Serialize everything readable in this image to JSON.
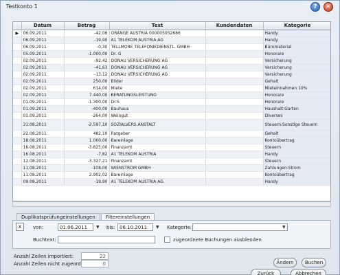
{
  "window": {
    "title": "Testkonto 1"
  },
  "table": {
    "headers": [
      "Datum",
      "Betrag",
      "Text",
      "Kundendaten",
      "Kategorie"
    ],
    "rows": [
      [
        "06.09.2011",
        "-42,06",
        "ORANGE AUSTRIA 000005052686",
        "",
        "Handy"
      ],
      [
        "06.09.2011",
        "-19,90",
        "A1 TELEKOM AUSTRIA AG",
        "",
        "Handy"
      ],
      [
        "06.09.2011",
        "-0,30",
        "TELLMORE TELEFONIEDIENSTL. GMBH",
        "",
        "Büromaterial"
      ],
      [
        "05.09.2011",
        "-1.000,00",
        "Dr. G",
        "",
        "Honorare"
      ],
      [
        "02.09.2011",
        "-92,42",
        "DONAU VERSICHERUNG AG",
        "",
        "Versicherung"
      ],
      [
        "02.09.2011",
        "-41,63",
        "DONAU VERSICHERUNG AG",
        "",
        "Versicherung"
      ],
      [
        "02.09.2011",
        "-13,12",
        "DONAU VERSICHERUNG AG",
        "",
        "Versicherung"
      ],
      [
        "02.09.2011",
        "250,00",
        "Bilder",
        "",
        "Gehalt"
      ],
      [
        "02.09.2011",
        "614,00",
        "Miete",
        "",
        "Mieteinnahmen 10%"
      ],
      [
        "02.09.2011",
        "7.440,00",
        "BERATUNGSLEISTUNG",
        "",
        "Honorare"
      ],
      [
        "01.09.2011",
        "-1.300,00",
        "Dr.S",
        "",
        "Honorare"
      ],
      [
        "01.09.2011",
        "-400,00",
        "Bauhaus",
        "",
        "Haushalt:Garten"
      ],
      [
        "01.09.2011",
        "-264,00",
        "Weingut",
        "",
        "Diverses"
      ],
      [
        "31.08.2011",
        "-2.597,10",
        "SOZIALVERS.ANSTALT",
        "",
        "Steuern:Sonstige Steuern"
      ],
      [
        "22.08.2011",
        "482,10",
        "Ratgeber",
        "",
        "Gehalt"
      ],
      [
        "18.08.2011",
        "1.000,00",
        "Bareinlage",
        "",
        "Kontoübertrag"
      ],
      [
        "16.08.2011",
        "-3.825,00",
        "Finanzamt",
        "",
        "Steuern"
      ],
      [
        "16.08.2011",
        "-7,82",
        "A1 TELEKOM AUSTRIA",
        "",
        "Handy"
      ],
      [
        "12.08.2011",
        "-3.327,21",
        "Finanzamt",
        "",
        "Steuern"
      ],
      [
        "11.08.2011",
        "-108,00",
        "WIENSTROM GMBH",
        "",
        "Zahlungen:Strom"
      ],
      [
        "11.08.2011",
        "2.902,02",
        "Bareinlage",
        "",
        "Kontoübertrag"
      ],
      [
        "09.08.2011",
        "-19,90",
        "A1 TELEKOM AUSTRIA AG",
        "",
        "Handy"
      ]
    ]
  },
  "tabs": [
    "Duplikatsprüfungeinstellungen",
    "Filtereinstellungen"
  ],
  "filter": {
    "von_label": "von:",
    "von_value": "01.06.2011",
    "bis_label": "bis:",
    "bis_value": "06.10.2011",
    "kategorie_label": "Kategorie:",
    "kategorie_value": "",
    "buchtext_label": "Buchtext:",
    "buchtext_value": "",
    "hide_assigned_label": "zugeordnete Buchungen ausblenden",
    "clear_glyph": "x"
  },
  "stats": {
    "imported_label": "Anzahl Zeilen importiert:",
    "imported_value": "22",
    "unassigned_label": "Anzahl Zeilen nicht zugeordnet:",
    "unassigned_value": "0"
  },
  "buttons": {
    "aendern": "Ändern",
    "buchen": "Buchen",
    "zurueck": "Zurück",
    "abbrechen": "Abbrechen"
  },
  "colors": {
    "accent": "#2b65b5",
    "category_bg": "#e4ebf6"
  }
}
